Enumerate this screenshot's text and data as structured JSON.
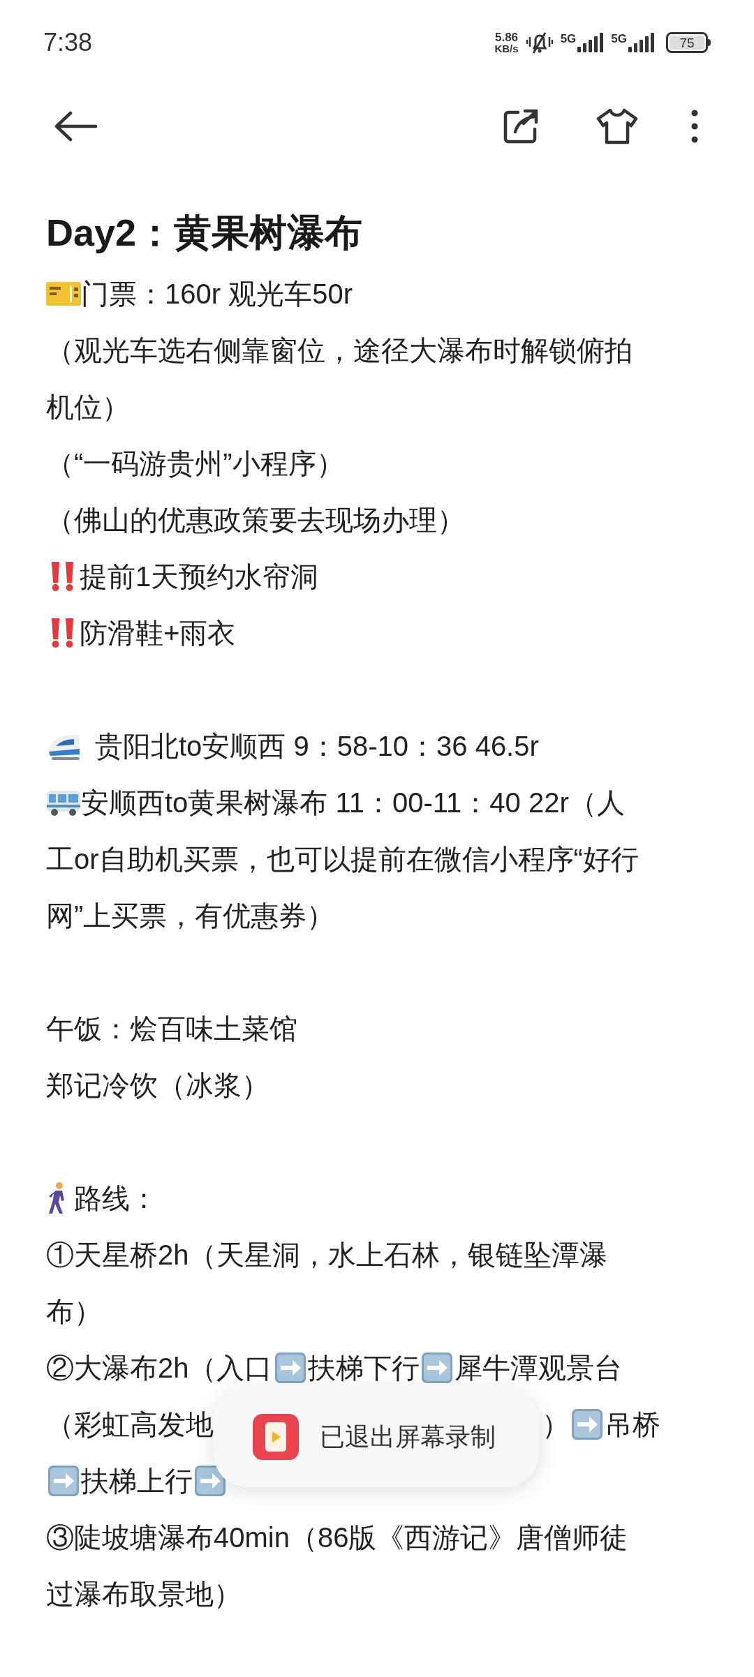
{
  "status_bar": {
    "time": "7:38",
    "speed_value": "5.86",
    "speed_unit": "KB/s",
    "networks": [
      "5G",
      "5G"
    ],
    "battery": "75"
  },
  "title": "Day2：黄果树瀑布",
  "lines": [
    {
      "kind": "ticket",
      "segments": [
        {
          "kind": "text",
          "text": "门票：160r 观光车50r"
        }
      ]
    },
    {
      "kind": "plain",
      "segments": [
        {
          "kind": "text",
          "text": "（观光车选右侧靠窗位，途径大瀑布时解锁俯拍"
        }
      ]
    },
    {
      "kind": "plain",
      "segments": [
        {
          "kind": "text",
          "text": "机位）"
        }
      ]
    },
    {
      "kind": "plain",
      "segments": [
        {
          "kind": "text",
          "text": "（“一码游贵州”小程序）"
        }
      ]
    },
    {
      "kind": "plain",
      "segments": [
        {
          "kind": "text",
          "text": "（佛山的优惠政策要去现场办理）"
        }
      ]
    },
    {
      "kind": "alert",
      "segments": [
        {
          "kind": "text",
          "text": "提前1天预约水帘洞"
        }
      ]
    },
    {
      "kind": "alert",
      "segments": [
        {
          "kind": "text",
          "text": "防滑鞋+雨衣"
        }
      ]
    },
    {
      "kind": "blank"
    },
    {
      "kind": "train",
      "segments": [
        {
          "kind": "text",
          "text": "贵阳北to安顺西 9：58-10：36 46.5r"
        }
      ]
    },
    {
      "kind": "bus",
      "segments": [
        {
          "kind": "text",
          "text": "安顺西to黄果树瀑布 11：00-11：40 22r（人"
        }
      ]
    },
    {
      "kind": "plain",
      "segments": [
        {
          "kind": "text",
          "text": "工or自助机买票，也可以提前在微信小程序“好行"
        }
      ]
    },
    {
      "kind": "plain",
      "segments": [
        {
          "kind": "text",
          "text": "网”上买票，有优惠券）"
        }
      ]
    },
    {
      "kind": "blank"
    },
    {
      "kind": "plain",
      "segments": [
        {
          "kind": "text",
          "text": "午饭：烩百味土菜馆"
        }
      ]
    },
    {
      "kind": "plain",
      "segments": [
        {
          "kind": "text",
          "text": "郑记冷饮（冰浆）"
        }
      ]
    },
    {
      "kind": "blank"
    },
    {
      "kind": "walker",
      "segments": [
        {
          "kind": "text",
          "text": "路线："
        }
      ]
    },
    {
      "kind": "plain",
      "segments": [
        {
          "kind": "text",
          "text": "①天星桥2h（天星洞，水上石林，银链坠潭瀑"
        }
      ]
    },
    {
      "kind": "plain",
      "segments": [
        {
          "kind": "text",
          "text": "布）"
        }
      ]
    },
    {
      "kind": "plain",
      "segments": [
        {
          "kind": "text",
          "text": "②大瀑布2h（入口"
        },
        {
          "kind": "arrow"
        },
        {
          "kind": "text",
          "text": "扶梯下行"
        },
        {
          "kind": "arrow"
        },
        {
          "kind": "text",
          "text": "犀牛潭观景台"
        }
      ]
    },
    {
      "kind": "plain",
      "segments": [
        {
          "kind": "text",
          "text": "（彩虹高发地"
        },
        {
          "kind": "gap"
        },
        {
          "kind": "text",
          "text": "）"
        },
        {
          "kind": "arrow"
        },
        {
          "kind": "text",
          "text": "吊桥"
        }
      ]
    },
    {
      "kind": "plain",
      "segments": [
        {
          "kind": "arrow"
        },
        {
          "kind": "text",
          "text": "扶梯上行"
        },
        {
          "kind": "arrow"
        }
      ]
    },
    {
      "kind": "plain",
      "segments": [
        {
          "kind": "text",
          "text": "③陡坡塘瀑布40min（86版《西游记》唐僧师徒"
        }
      ]
    },
    {
      "kind": "plain",
      "segments": [
        {
          "kind": "text",
          "text": "过瀑布取景地）"
        }
      ]
    }
  ],
  "toast": {
    "text": "已退出屏幕录制"
  }
}
